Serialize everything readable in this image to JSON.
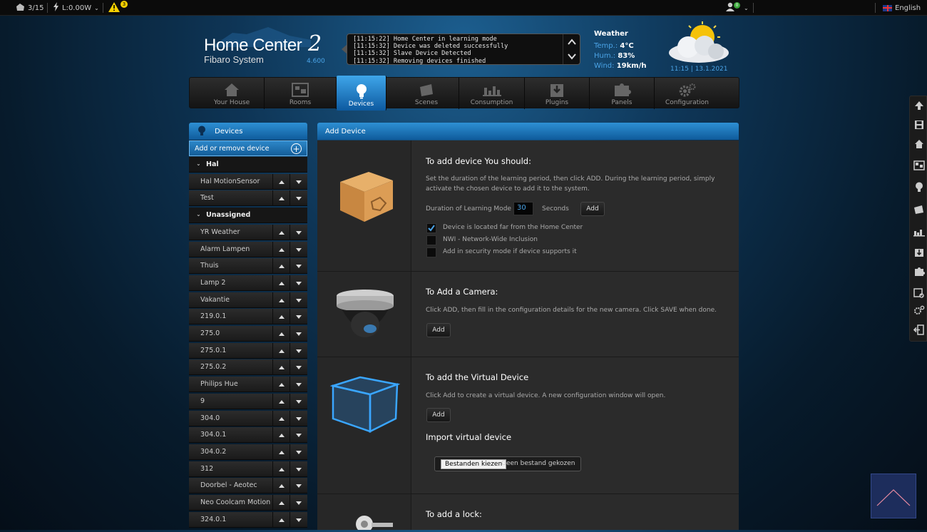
{
  "topbar": {
    "devices_count": "3/15",
    "power": "L:0.00W",
    "warning_count": "3",
    "user_badge": "0",
    "language": "English"
  },
  "header": {
    "title": "Home Center",
    "title_num": "2",
    "subtitle": "Fibaro System",
    "version": "4.600",
    "events": [
      "[11:15:22] Home Center in learning mode",
      "[11:15:32] Device was deleted successfully",
      "[11:15:32] Slave Device Detected",
      "[11:15:32] Removing devices finished"
    ],
    "weather": {
      "title": "Weather",
      "temp_label": "Temp.:",
      "temp_value": "4°C",
      "hum_label": "Hum.:",
      "hum_value": "83%",
      "wind_label": "Wind:",
      "wind_value": "19km/h",
      "time": "11:15 | 13.1.2021"
    }
  },
  "nav": [
    {
      "label": "Your House",
      "icon": "house-icon"
    },
    {
      "label": "Rooms",
      "icon": "rooms-icon"
    },
    {
      "label": "Devices",
      "icon": "bulb-icon",
      "active": true
    },
    {
      "label": "Scenes",
      "icon": "scenes-icon"
    },
    {
      "label": "Consumption",
      "icon": "chart-icon"
    },
    {
      "label": "Plugins",
      "icon": "plugin-icon"
    },
    {
      "label": "Panels",
      "icon": "puzzle-icon"
    },
    {
      "label": "Configuration",
      "icon": "gears-icon"
    }
  ],
  "sidebar": {
    "title": "Devices",
    "add_label": "Add or remove device",
    "rows": [
      {
        "label": "Hal",
        "group": true
      },
      {
        "label": "Hal MotionSensor"
      },
      {
        "label": "Test"
      },
      {
        "label": "Unassigned",
        "group": true
      },
      {
        "label": "YR Weather"
      },
      {
        "label": "Alarm Lampen"
      },
      {
        "label": "Thuis"
      },
      {
        "label": "Lamp 2"
      },
      {
        "label": "Vakantie"
      },
      {
        "label": "219.0.1"
      },
      {
        "label": "275.0"
      },
      {
        "label": "275.0.1"
      },
      {
        "label": "275.0.2"
      },
      {
        "label": "Philips Hue"
      },
      {
        "label": "9"
      },
      {
        "label": "304.0"
      },
      {
        "label": "304.0.1"
      },
      {
        "label": "304.0.2"
      },
      {
        "label": "312"
      },
      {
        "label": "Doorbel - Aeotec"
      },
      {
        "label": "Neo Coolcam Motion"
      },
      {
        "label": "324.0.1"
      }
    ]
  },
  "main": {
    "title": "Add Device",
    "device": {
      "heading": "To add device You should:",
      "desc": "Set the duration of the learning period, then click ADD. During the learning period, simply activate the chosen device to add it to the system.",
      "duration_label": "Duration of Learning Mode",
      "duration_value": "30",
      "seconds_label": "Seconds",
      "add_label": "Add",
      "opt_far": "Device is located far from the Home Center",
      "opt_far_checked": true,
      "opt_nwi": "NWI - Network-Wide Inclusion",
      "opt_secure": "Add in security mode if device supports it"
    },
    "camera": {
      "heading": "To Add a Camera:",
      "desc": "Click ADD, then fill in the configuration details for the new camera. Click SAVE when done.",
      "add_label": "Add"
    },
    "virtual": {
      "heading": "To add the Virtual Device",
      "desc": "Click Add to create a virtual device. A new configuration window will open.",
      "add_label": "Add",
      "import_heading": "Import virtual device",
      "choose_label": "Bestanden kiezen",
      "no_file_label": "Geen bestand gekozen"
    },
    "lock": {
      "heading": "To add a lock:"
    }
  },
  "colors": {
    "accent": "#2e90d4",
    "link_blue": "#4aa3e6",
    "warning": "#f5d000"
  }
}
